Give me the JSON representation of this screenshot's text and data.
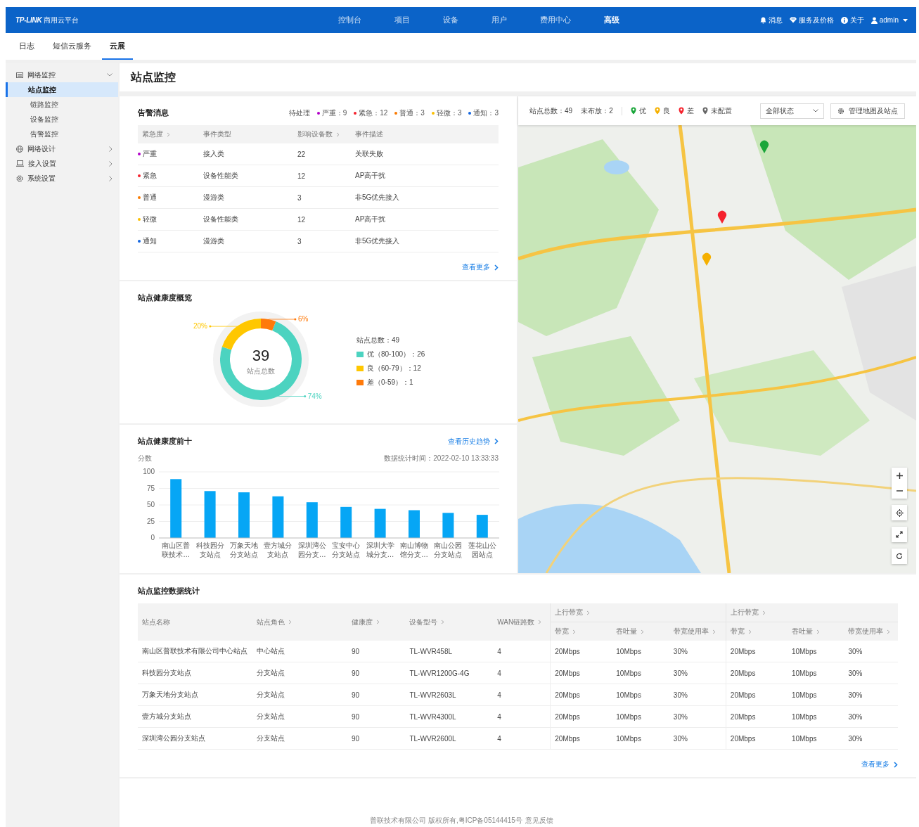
{
  "header": {
    "logo": "TP-LINK",
    "product": "商用云平台",
    "nav": [
      {
        "label": "控制台",
        "selected": false
      },
      {
        "label": "项目",
        "selected": false
      },
      {
        "label": "设备",
        "selected": false
      },
      {
        "label": "用户",
        "selected": false
      },
      {
        "label": "费用中心",
        "selected": false
      },
      {
        "label": "高级",
        "selected": true
      }
    ],
    "actions": [
      {
        "kind": "bell",
        "label": "消息"
      },
      {
        "kind": "diamond",
        "label": "服务及价格"
      },
      {
        "kind": "info",
        "label": "关于"
      },
      {
        "kind": "user",
        "label": "admin"
      }
    ]
  },
  "subnav": {
    "tabs": [
      {
        "label": "日志",
        "selected": false
      },
      {
        "label": "短信云服务",
        "selected": false
      },
      {
        "label": "云展",
        "selected": true
      }
    ]
  },
  "sidebar": {
    "items": [
      {
        "label": "网络监控",
        "expanded": true,
        "children": [
          {
            "label": "站点监控",
            "selected": true
          },
          {
            "label": "链路监控",
            "selected": false
          },
          {
            "label": "设备监控",
            "selected": false
          },
          {
            "label": "告警监控",
            "selected": false
          }
        ]
      },
      {
        "label": "网络设计",
        "expanded": false
      },
      {
        "label": "接入设置",
        "expanded": false
      },
      {
        "label": "系统设置",
        "expanded": false
      }
    ]
  },
  "page_title": "站点监控",
  "alerts": {
    "title": "告警消息",
    "pending_label": "待处理",
    "summary": [
      {
        "label": "严重：9",
        "color": "#b200c8"
      },
      {
        "label": "紧急：12",
        "color": "#f5222d"
      },
      {
        "label": "普通：3",
        "color": "#fa7a00"
      },
      {
        "label": "轻微：3",
        "color": "#fbbf00"
      },
      {
        "label": "通知：3",
        "color": "#1466e0"
      }
    ],
    "columns": [
      {
        "label": "紧急度",
        "sortable": true
      },
      {
        "label": "事件类型",
        "sortable": false
      },
      {
        "label": "影响设备数",
        "sortable": true
      },
      {
        "label": "事件描述",
        "sortable": false
      }
    ],
    "rows": [
      {
        "level": "严重",
        "color": "#b200c8",
        "type": "接入类",
        "count": "22",
        "description": "关联失败"
      },
      {
        "level": "紧急",
        "color": "#f5222d",
        "type": "设备性能类",
        "count": "12",
        "description": "AP高干扰"
      },
      {
        "level": "普通",
        "color": "#fa7a00",
        "type": "漫游类",
        "count": "3",
        "description": "非5G优先接入"
      },
      {
        "level": "轻微",
        "color": "#fbbf00",
        "type": "设备性能类",
        "count": "12",
        "description": "AP高干扰"
      },
      {
        "level": "通知",
        "color": "#1466e0",
        "type": "漫游类",
        "count": "3",
        "description": "非5G优先接入"
      }
    ],
    "more": "查看更多"
  },
  "health": {
    "title": "站点健康度概览",
    "center_value": "39",
    "center_label": "站点总数",
    "total": "站点总数：49",
    "legend": [
      {
        "label": "优（80-100）：26",
        "color": "#4cd3c0"
      },
      {
        "label": "良（60-79）：12",
        "color": "#ffc700"
      },
      {
        "label": "差（0-59）：1",
        "color": "#ff7a0a"
      }
    ],
    "chart_data": {
      "type": "donut",
      "values": [
        74,
        20,
        6
      ],
      "value_labels": [
        "74%",
        "20%",
        "6%"
      ]
    }
  },
  "top10": {
    "title": "站点健康度前十",
    "link": "查看历史趋势",
    "time": "数据统计时间：2022-02-10 13:33:33",
    "chart_data": {
      "type": "bar",
      "ylabel": "分数",
      "categories": [
        "南山区普联技术…",
        "科技园分支站点",
        "万象天地分支站点",
        "壹方城分支站点",
        "深圳湾公园分支…",
        "宝安中心分支站点",
        "深圳大学城分支…",
        "南山博物馆分支…",
        "南山公园分支站点",
        "莲花山公园站点"
      ],
      "values": [
        89,
        71,
        69,
        63,
        54,
        47,
        44,
        42,
        38,
        35
      ],
      "ylim": [
        0,
        100
      ],
      "yticks": [
        0,
        25,
        50,
        75,
        100
      ],
      "grid": true
    }
  },
  "map": {
    "total": "站点总数：49",
    "undeployed": "未布放：2",
    "legend": [
      {
        "label": "优",
        "color": "#1aa63a"
      },
      {
        "label": "良",
        "color": "#f5b000"
      },
      {
        "label": "差",
        "color": "#f5222d"
      },
      {
        "label": "未配置",
        "color": "#666666"
      }
    ],
    "filter": "全部状态",
    "manage_button": "管理地图及站点"
  },
  "stats": {
    "title": "站点监控数据统计",
    "columns": [
      {
        "label": "站点名称",
        "sortable": false
      },
      {
        "label": "站点角色",
        "sortable": true
      },
      {
        "label": "健康度",
        "sortable": true
      },
      {
        "label": "设备型号",
        "sortable": true
      },
      {
        "label": "WAN链路数",
        "sortable": true
      }
    ],
    "groups": [
      {
        "label": "上行带宽",
        "sortable": true,
        "columns": [
          {
            "label": "带宽",
            "sortable": true
          },
          {
            "label": "吞吐量",
            "sortable": true
          },
          {
            "label": "带宽使用率",
            "sortable": true
          }
        ]
      },
      {
        "label": "上行带宽",
        "sortable": true,
        "columns": [
          {
            "label": "带宽",
            "sortable": true
          },
          {
            "label": "吞吐量",
            "sortable": true
          },
          {
            "label": "带宽使用率",
            "sortable": true
          }
        ]
      }
    ],
    "rows": [
      {
        "cells": [
          "南山区普联技术有限公司中心站点",
          "中心站点",
          "90",
          "TL-WVR458L",
          "4",
          "20Mbps",
          "10Mbps",
          "30%",
          "20Mbps",
          "10Mbps",
          "30%"
        ]
      },
      {
        "cells": [
          "科技园分支站点",
          "分支站点",
          "90",
          "TL-WVR1200G-4G",
          "4",
          "20Mbps",
          "10Mbps",
          "30%",
          "20Mbps",
          "10Mbps",
          "30%"
        ]
      },
      {
        "cells": [
          "万象天地分支站点",
          "分支站点",
          "90",
          "TL-WVR2603L",
          "4",
          "20Mbps",
          "10Mbps",
          "30%",
          "20Mbps",
          "10Mbps",
          "30%"
        ]
      },
      {
        "cells": [
          "壹方城分支站点",
          "分支站点",
          "90",
          "TL-WVR4300L",
          "4",
          "20Mbps",
          "10Mbps",
          "30%",
          "20Mbps",
          "10Mbps",
          "30%"
        ]
      },
      {
        "cells": [
          "深圳湾公园分支站点",
          "分支站点",
          "90",
          "TL-WVR2600L",
          "4",
          "20Mbps",
          "10Mbps",
          "30%",
          "20Mbps",
          "10Mbps",
          "30%"
        ]
      }
    ],
    "more": "查看更多"
  },
  "footer": {
    "copyright": "普联技术有限公司 版权所有,粤ICP备05144415号",
    "feedback": "意见反馈"
  }
}
